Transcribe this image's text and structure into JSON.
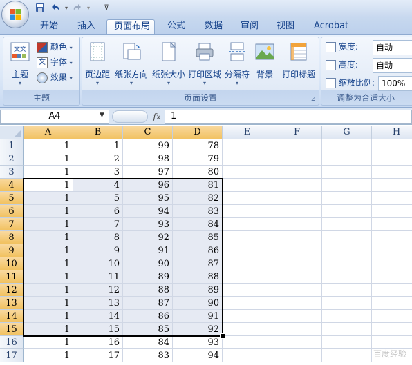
{
  "tabs": [
    "开始",
    "插入",
    "页面布局",
    "公式",
    "数据",
    "审阅",
    "视图",
    "Acrobat"
  ],
  "active_tab_index": 2,
  "ribbon": {
    "theme_group": {
      "label": "主题",
      "theme_button": "主题",
      "colors": "颜色",
      "fonts": "字体",
      "effects": "效果"
    },
    "page_setup_group": {
      "label": "页面设置",
      "margins": "页边距",
      "orientation": "纸张方向",
      "size": "纸张大小",
      "print_area": "打印区域",
      "breaks": "分隔符",
      "background": "背景",
      "print_titles": "打印标题"
    },
    "scale_group": {
      "label": "调整为合适大小",
      "width_label": "宽度:",
      "width_value": "自动",
      "height_label": "高度:",
      "height_value": "自动",
      "scale_label": "缩放比例:",
      "scale_value": "100%"
    }
  },
  "formula_bar": {
    "name_box": "A4",
    "fx": "fx",
    "content": "1"
  },
  "columns": [
    "A",
    "B",
    "C",
    "D",
    "E",
    "F",
    "G",
    "H"
  ],
  "selected_columns": [
    "A",
    "B",
    "C",
    "D"
  ],
  "selection": {
    "from": "A4",
    "to": "D15",
    "active_cell": "A4"
  },
  "rows": [
    {
      "n": "1",
      "A": "1",
      "B": "1",
      "C": "99",
      "D": "78"
    },
    {
      "n": "2",
      "A": "1",
      "B": "2",
      "C": "98",
      "D": "79"
    },
    {
      "n": "3",
      "A": "1",
      "B": "3",
      "C": "97",
      "D": "80"
    },
    {
      "n": "4",
      "A": "1",
      "B": "4",
      "C": "96",
      "D": "81"
    },
    {
      "n": "5",
      "A": "1",
      "B": "5",
      "C": "95",
      "D": "82"
    },
    {
      "n": "6",
      "A": "1",
      "B": "6",
      "C": "94",
      "D": "83"
    },
    {
      "n": "7",
      "A": "1",
      "B": "7",
      "C": "93",
      "D": "84"
    },
    {
      "n": "8",
      "A": "1",
      "B": "8",
      "C": "92",
      "D": "85"
    },
    {
      "n": "9",
      "A": "1",
      "B": "9",
      "C": "91",
      "D": "86"
    },
    {
      "n": "10",
      "A": "1",
      "B": "10",
      "C": "90",
      "D": "87"
    },
    {
      "n": "11",
      "A": "1",
      "B": "11",
      "C": "89",
      "D": "88"
    },
    {
      "n": "12",
      "A": "1",
      "B": "12",
      "C": "88",
      "D": "89"
    },
    {
      "n": "13",
      "A": "1",
      "B": "13",
      "C": "87",
      "D": "90"
    },
    {
      "n": "14",
      "A": "1",
      "B": "14",
      "C": "86",
      "D": "91"
    },
    {
      "n": "15",
      "A": "1",
      "B": "15",
      "C": "85",
      "D": "92"
    },
    {
      "n": "16",
      "A": "1",
      "B": "16",
      "C": "84",
      "D": "93"
    },
    {
      "n": "17",
      "A": "1",
      "B": "17",
      "C": "83",
      "D": "94"
    }
  ],
  "icons": {
    "office_button": "office-logo-icon",
    "save": "save-icon",
    "undo": "undo-icon",
    "redo": "redo-icon",
    "customize": "customize-qat-icon"
  },
  "colors": {
    "selection_fill": "#e6eaf3",
    "header_highlight": "#f1c15f",
    "ribbon_text": "#15428b"
  },
  "watermark": "百度经验"
}
